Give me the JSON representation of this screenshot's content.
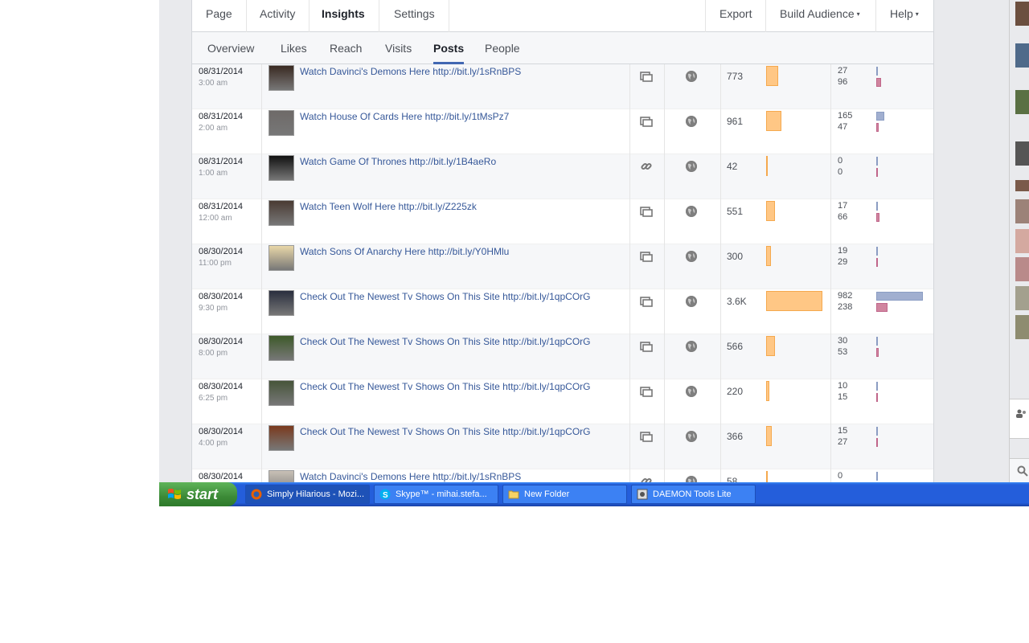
{
  "top_nav": {
    "left": [
      "Page",
      "Activity",
      "Insights",
      "Settings"
    ],
    "active": "Insights",
    "export": "Export",
    "build_audience": "Build Audience",
    "help": "Help"
  },
  "sub_nav": {
    "tabs": [
      "Overview",
      "Likes",
      "Reach",
      "Visits",
      "Posts",
      "People"
    ],
    "active": "Posts"
  },
  "icons": {
    "type_photo": "photo-icon",
    "type_link": "link-icon",
    "audience": "globe-icon",
    "caret": "▾"
  },
  "colors": {
    "reach_bar": "#ffc785",
    "engagement_bar_1": "#a1afd0",
    "engagement_bar_2": "#d0859f",
    "link": "#365899"
  },
  "posts": [
    {
      "date": "08/31/2014",
      "time": "3:00 am",
      "message": "Watch Davinci's Demons Here http://bit.ly/1sRnBPS",
      "type": "photo",
      "reach": "773",
      "reach_value": 773,
      "eng1": "27",
      "eng1_value": 27,
      "eng2": "96",
      "eng2_value": 96
    },
    {
      "date": "08/31/2014",
      "time": "2:00 am",
      "message": "Watch House Of Cards Here http://bit.ly/1tMsPz7",
      "type": "photo",
      "reach": "961",
      "reach_value": 961,
      "eng1": "165",
      "eng1_value": 165,
      "eng2": "47",
      "eng2_value": 47
    },
    {
      "date": "08/31/2014",
      "time": "1:00 am",
      "message": "Watch Game Of Thrones http://bit.ly/1B4aeRo",
      "type": "link",
      "reach": "42",
      "reach_value": 42,
      "eng1": "0",
      "eng1_value": 0,
      "eng2": "0",
      "eng2_value": 0
    },
    {
      "date": "08/31/2014",
      "time": "12:00 am",
      "message": "Watch Teen Wolf Here http://bit.ly/Z225zk",
      "type": "photo",
      "reach": "551",
      "reach_value": 551,
      "eng1": "17",
      "eng1_value": 17,
      "eng2": "66",
      "eng2_value": 66
    },
    {
      "date": "08/30/2014",
      "time": "11:00 pm",
      "message": "Watch Sons Of Anarchy Here http://bit.ly/Y0HMlu",
      "type": "photo",
      "reach": "300",
      "reach_value": 300,
      "eng1": "19",
      "eng1_value": 19,
      "eng2": "29",
      "eng2_value": 29
    },
    {
      "date": "08/30/2014",
      "time": "9:30 pm",
      "message": "Check Out The Newest Tv Shows On This Site http://bit.ly/1qpCOrG",
      "type": "photo",
      "reach": "3.6K",
      "reach_value": 3600,
      "eng1": "982",
      "eng1_value": 982,
      "eng2": "238",
      "eng2_value": 238
    },
    {
      "date": "08/30/2014",
      "time": "8:00 pm",
      "message": "Check Out The Newest Tv Shows On This Site http://bit.ly/1qpCOrG",
      "type": "photo",
      "reach": "566",
      "reach_value": 566,
      "eng1": "30",
      "eng1_value": 30,
      "eng2": "53",
      "eng2_value": 53
    },
    {
      "date": "08/30/2014",
      "time": "6:25 pm",
      "message": "Check Out The Newest Tv Shows On This Site http://bit.ly/1qpCOrG",
      "type": "photo",
      "reach": "220",
      "reach_value": 220,
      "eng1": "10",
      "eng1_value": 10,
      "eng2": "15",
      "eng2_value": 15
    },
    {
      "date": "08/30/2014",
      "time": "4:00 pm",
      "message": "Check Out The Newest Tv Shows On This Site http://bit.ly/1qpCOrG",
      "type": "photo",
      "reach": "366",
      "reach_value": 366,
      "eng1": "15",
      "eng1_value": 15,
      "eng2": "27",
      "eng2_value": 27
    },
    {
      "date": "08/30/2014",
      "time": "",
      "message": "Watch Davinci's Demons Here http://bit.ly/1sRnBPS",
      "type": "link",
      "reach": "58",
      "reach_value": 58,
      "eng1": "0",
      "eng1_value": 0,
      "eng2": "",
      "eng2_value": 0
    }
  ],
  "taskbar": {
    "start_label": "start",
    "tasks": [
      {
        "label": "Simply Hilarious - Mozi...",
        "icon": "firefox-icon",
        "active": true
      },
      {
        "label": "Skype™ - mihai.stefa...",
        "icon": "skype-icon",
        "active": false
      },
      {
        "label": "New Folder",
        "icon": "folder-icon",
        "active": false
      },
      {
        "label": "DAEMON Tools Lite",
        "icon": "daemon-tools-icon",
        "active": false
      }
    ]
  }
}
